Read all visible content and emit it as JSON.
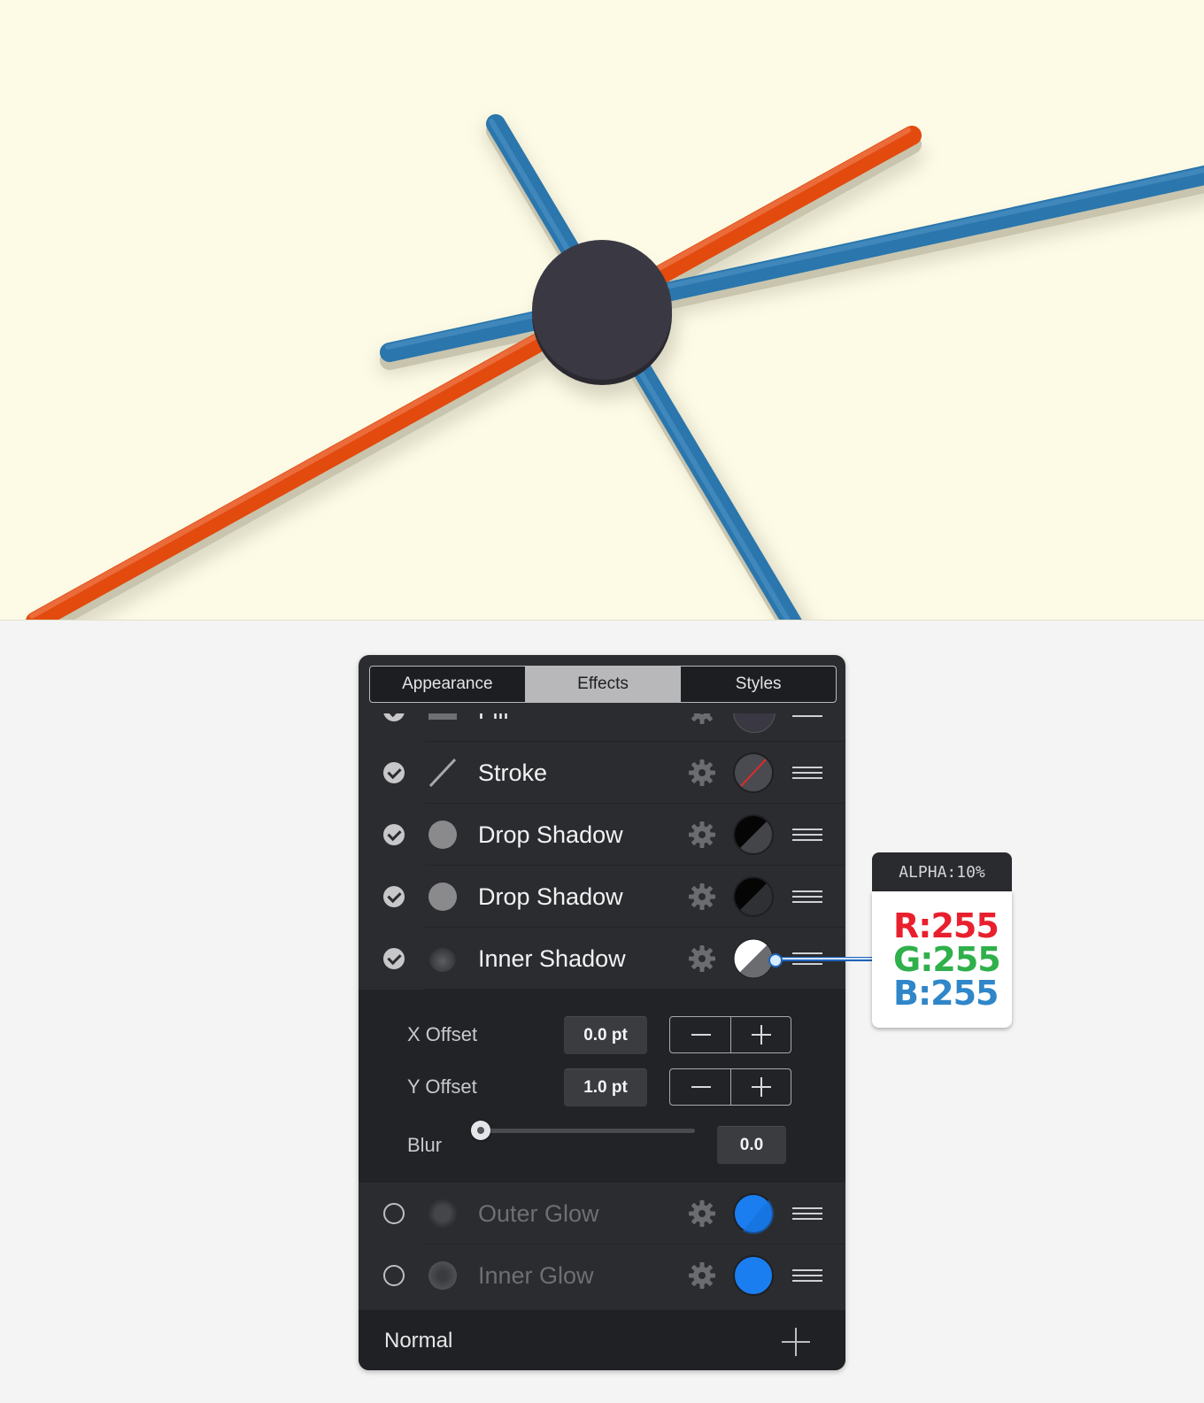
{
  "canvas": {
    "background": "#fdfbe6",
    "shape_colors": {
      "red": "#e24a0e",
      "blue": "#2a76ad",
      "center": "#3a3943"
    }
  },
  "panel": {
    "tabs": [
      {
        "label": "Appearance",
        "active": false
      },
      {
        "label": "Effects",
        "active": true
      },
      {
        "label": "Styles",
        "active": false
      }
    ],
    "effects": [
      {
        "label": "Fill",
        "enabled": true,
        "icon": "fill-rect-icon",
        "swatch": "dark"
      },
      {
        "label": "Stroke",
        "enabled": true,
        "icon": "stroke-line-icon",
        "swatch": "none"
      },
      {
        "label": "Drop Shadow",
        "enabled": true,
        "icon": "shadow-circle-icon",
        "swatch": "black"
      },
      {
        "label": "Drop Shadow",
        "enabled": true,
        "icon": "shadow-circle-icon",
        "swatch": "black"
      },
      {
        "label": "Inner Shadow",
        "enabled": true,
        "icon": "inner-shadow-icon",
        "swatch": "white",
        "expanded": true
      },
      {
        "label": "Outer Glow",
        "enabled": false,
        "icon": "glow-circle-icon",
        "swatch": "#1a7ef0"
      },
      {
        "label": "Inner Glow",
        "enabled": false,
        "icon": "glow-circle-icon",
        "swatch": "#1a7ef0"
      }
    ],
    "inner_shadow_settings": {
      "x_offset_label": "X Offset",
      "x_offset_value": "0.0 pt",
      "y_offset_label": "Y Offset",
      "y_offset_value": "1.0 pt",
      "blur_label": "Blur",
      "blur_value": "0.0",
      "blur_slider_fraction": 0.0
    },
    "blend_mode": "Normal"
  },
  "color_tooltip": {
    "alpha": "ALPHA:10%",
    "r": "R:255",
    "g": "G:255",
    "b": "B:255",
    "colors": {
      "r": "#e8202e",
      "g": "#2fb04a",
      "b": "#2f86c9"
    }
  }
}
